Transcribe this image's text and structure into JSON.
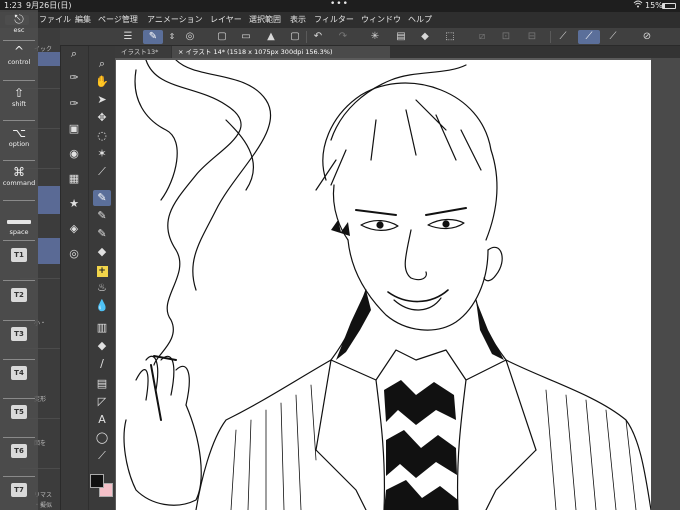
{
  "status_bar": {
    "time": "1:23",
    "date": "9月26日(日)",
    "multitask_dots": "•••",
    "wifi_icon": "wifi-icon",
    "battery_percent": "15%",
    "battery_level": 0.15
  },
  "menu": {
    "items": [
      "ファイル",
      "編集",
      "ページ管理",
      "アニメーション",
      "レイヤー",
      "選択範囲",
      "表示",
      "フィルター",
      "ウィンドウ",
      "ヘルプ"
    ]
  },
  "tabs": [
    {
      "label": "イラスト13*"
    },
    {
      "label": "× イラスト 14* (1518 x 1075px 300dpi 156.3%)"
    }
  ],
  "edge_keys": {
    "esc": "esc",
    "control": "control",
    "shift": "shift",
    "option": "option",
    "command": "command",
    "space": "space",
    "custom": [
      "T1",
      "T2",
      "T3",
      "T4",
      "T5",
      "T6",
      "T7"
    ]
  },
  "sub_panel": {
    "fragments": [
      "イック",
      "小・",
      "変形",
      "面を",
      "リマス",
      "・擬似"
    ]
  },
  "colors": {
    "accent": "#5b6f9a",
    "status_bg": "#1e1e1e",
    "panel_bg": "#3a3a3a",
    "main_color": "#111111",
    "sub_color": "#f4c0c8"
  }
}
